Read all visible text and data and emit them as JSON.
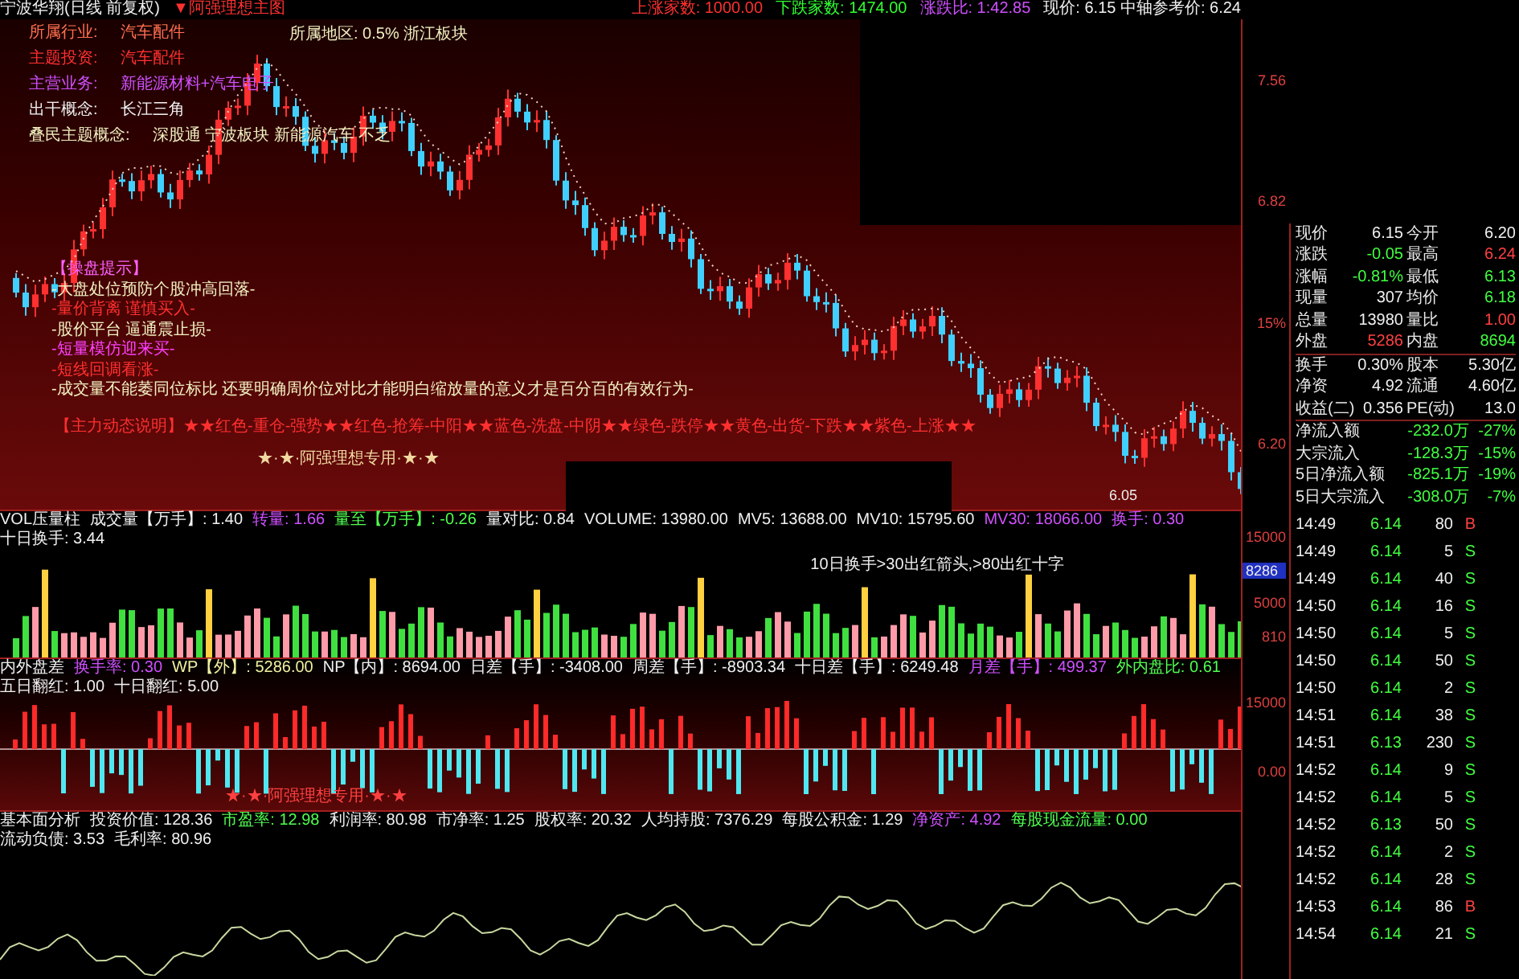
{
  "header": {
    "title": "宁波华翔(日线 前复权)",
    "indicator": "▼阿强理想主图",
    "stats": [
      {
        "text": "上涨家数: 1000.00",
        "color": "#ff3030"
      },
      {
        "text": "下跌家数: 1474.00",
        "color": "#30ff30"
      },
      {
        "text": "涨跌比: 1:42.85",
        "color": "#d050ff"
      }
    ],
    "price_info": "现价: 6.15 中轴参考价: 6.24"
  },
  "main_chart": {
    "info": [
      {
        "label": "所属行业:",
        "value": "汽车配件",
        "color": "#ff7050"
      },
      {
        "label": "主题投资:",
        "value": "汽车配件",
        "color": "#ff3030"
      },
      {
        "label": "主营业务:",
        "value": "新能源材料+汽车电子",
        "color": "#d050ff"
      },
      {
        "label": "出干概念:",
        "value": "长江三角",
        "color": "#f0f0f0"
      },
      {
        "label": "叠民主题概念:",
        "value": "深股通 宁波板块 新能源汽车 不乏",
        "color": "#f0f0c0"
      }
    ],
    "region": "所属地区: 0.5% 浙江板块",
    "tips": [
      {
        "text": "【操盘提示】",
        "color": "#ff60ff"
      },
      {
        "text": "-大盘处位预防个股冲高回落-",
        "color": "#f0f0c0"
      },
      {
        "text": "-量价背离 谨慎买入-",
        "color": "#ff3030"
      },
      {
        "text": "-股价平台 逼通震止损-",
        "color": "#f0f0c0"
      },
      {
        "text": "-短量模仿迎来买-",
        "color": "#ff40ff"
      },
      {
        "text": "-短线回调看涨-",
        "color": "#ff3030"
      },
      {
        "text": "-成交量不能萎同位标比 还要明确周价位对比才能明白缩放量的意义才是百分百的有效行为-",
        "color": "#f0f0c0"
      }
    ],
    "legend": "【主力动态说明】★★红色-重仓-强势★★红色-抢筹-中阳★★蓝色-洗盘-中阴★★绿色-跌停★★黄色-出货-下跌★★紫色-上涨★★",
    "signature": "★·★·阿强理想专用·★·★",
    "low_label": "6.05",
    "axis": [
      "7.56",
      "6.82",
      "15%",
      "6.20"
    ]
  },
  "volume_panel": {
    "items": [
      {
        "text": "VOL压量柱",
        "color": "#f0f0f0"
      },
      {
        "text": "成交量【万手】: 1.40",
        "color": "#f0f0f0"
      },
      {
        "text": "转量: 1.66",
        "color": "#d050ff"
      },
      {
        "text": "量至【万手】: -0.26",
        "color": "#50ff50"
      },
      {
        "text": "量对比: 0.84",
        "color": "#f0f0f0"
      },
      {
        "text": "VOLUME: 13980.00",
        "color": "#f0f0f0"
      },
      {
        "text": "MV5: 13688.00",
        "color": "#f0f0f0"
      },
      {
        "text": "MV10: 15795.60",
        "color": "#f0f0f0"
      },
      {
        "text": "MV30: 18066.00",
        "color": "#d050ff"
      },
      {
        "text": "换手: 0.30",
        "color": "#d050ff"
      },
      {
        "text": "十日换手: 3.44",
        "color": "#f0f0f0"
      }
    ],
    "note": "10日换手>30出红箭头,>80出红十字",
    "axis": [
      "15000",
      "5000",
      "810"
    ],
    "marker": "8286"
  },
  "diff_panel": {
    "items": [
      {
        "text": "内外盘差",
        "color": "#f0f0f0"
      },
      {
        "text": "换手率: 0.30",
        "color": "#d050ff"
      },
      {
        "text": "WP【外】: 5286.00",
        "color": "#f0f0a0"
      },
      {
        "text": "NP【内】: 8694.00",
        "color": "#f0f0f0"
      },
      {
        "text": "日差【手】: -3408.00",
        "color": "#f0f0f0"
      },
      {
        "text": "周差【手】: -8903.34",
        "color": "#f0f0f0"
      },
      {
        "text": "十日差【手】: 6249.48",
        "color": "#f0f0f0"
      },
      {
        "text": "月差【手】: 499.37",
        "color": "#d050ff"
      },
      {
        "text": "外内盘比: 0.61",
        "color": "#50ff50"
      },
      {
        "text": "五日翻红: 1.00",
        "color": "#f0f0f0"
      },
      {
        "text": "十日翻红: 5.00",
        "color": "#f0f0f0"
      }
    ],
    "signature": "★·★·阿强理想专用·★·★",
    "axis": [
      "15000",
      "0.00"
    ]
  },
  "fundamental_panel": {
    "items": [
      {
        "text": "基本面分析",
        "color": "#f0f0f0"
      },
      {
        "text": "投资价值: 128.36",
        "color": "#f0f0f0"
      },
      {
        "text": "市盈率: 12.98",
        "color": "#50ff50"
      },
      {
        "text": "利润率: 80.98",
        "color": "#f0f0f0"
      },
      {
        "text": "市净率: 1.25",
        "color": "#f0f0f0"
      },
      {
        "text": "股权率: 20.32",
        "color": "#f0f0f0"
      },
      {
        "text": "人均持股: 7376.29",
        "color": "#f0f0f0"
      },
      {
        "text": "每股公积金: 1.29",
        "color": "#f0f0f0"
      },
      {
        "text": "净资产: 4.92",
        "color": "#d050ff"
      },
      {
        "text": "每股现金流量: 0.00",
        "color": "#50ff50"
      },
      {
        "text": "流动负债: 3.53",
        "color": "#f0f0f0"
      },
      {
        "text": "毛利率: 80.96",
        "color": "#f0f0f0"
      }
    ]
  },
  "quote": [
    {
      "cells": [
        {
          "label": "现价",
          "value": "6.15",
          "color": "#f0f0f0"
        },
        {
          "label": "今开",
          "value": "6.20",
          "color": "#f0f0f0"
        }
      ]
    },
    {
      "cells": [
        {
          "label": "涨跌",
          "value": "-0.05",
          "color": "#40ff40"
        },
        {
          "label": "最高",
          "value": "6.24",
          "color": "#ff4040"
        }
      ]
    },
    {
      "cells": [
        {
          "label": "涨幅",
          "value": "-0.81%",
          "color": "#40ff40"
        },
        {
          "label": "最低",
          "value": "6.13",
          "color": "#40ff40"
        }
      ]
    },
    {
      "cells": [
        {
          "label": "现量",
          "value": "307",
          "color": "#f0f0f0"
        },
        {
          "label": "均价",
          "value": "6.18",
          "color": "#40ff40"
        }
      ]
    },
    {
      "cells": [
        {
          "label": "总量",
          "value": "13980",
          "color": "#f0f0f0"
        },
        {
          "label": "量比",
          "value": "1.00",
          "color": "#ff4040"
        }
      ]
    },
    {
      "cells": [
        {
          "label": "外盘",
          "value": "5286",
          "color": "#ff4040"
        },
        {
          "label": "内盘",
          "value": "8694",
          "color": "#40ff40"
        }
      ]
    },
    {
      "cells": [
        {
          "label": "换手",
          "value": "0.30%",
          "color": "#f0f0f0"
        },
        {
          "label": "股本",
          "value": "5.30亿",
          "color": "#f0f0f0"
        }
      ]
    },
    {
      "cells": [
        {
          "label": "净资",
          "value": "4.92",
          "color": "#f0f0f0"
        },
        {
          "label": "流通",
          "value": "4.60亿",
          "color": "#f0f0f0"
        }
      ]
    },
    {
      "cells": [
        {
          "label": "收益(二)",
          "value": "0.356",
          "color": "#f0f0f0"
        },
        {
          "label": "PE(动)",
          "value": "13.0",
          "color": "#f0f0f0"
        }
      ]
    }
  ],
  "flows": [
    {
      "label": "净流入额",
      "value": "-232.0万",
      "percent": "-27%"
    },
    {
      "label": "大宗流入",
      "value": "-128.3万",
      "percent": "-15%"
    },
    {
      "label": "5日净流入额",
      "value": "-825.1万",
      "percent": "-19%"
    },
    {
      "label": "5日大宗流入",
      "value": "-308.0万",
      "percent": "-7%"
    }
  ],
  "ticks": [
    {
      "time": "14:49",
      "price": "6.14",
      "volume": "80",
      "side": "B",
      "kind": "buy"
    },
    {
      "time": "14:49",
      "price": "6.14",
      "volume": "5",
      "side": "S",
      "kind": "sell"
    },
    {
      "time": "14:49",
      "price": "6.14",
      "volume": "40",
      "side": "S",
      "kind": "sell"
    },
    {
      "time": "14:50",
      "price": "6.14",
      "volume": "16",
      "side": "S",
      "kind": "sell"
    },
    {
      "time": "14:50",
      "price": "6.14",
      "volume": "5",
      "side": "S",
      "kind": "sell"
    },
    {
      "time": "14:50",
      "price": "6.14",
      "volume": "50",
      "side": "S",
      "kind": "sell"
    },
    {
      "time": "14:50",
      "price": "6.14",
      "volume": "2",
      "side": "S",
      "kind": "sell"
    },
    {
      "time": "14:51",
      "price": "6.14",
      "volume": "38",
      "side": "S",
      "kind": "sell"
    },
    {
      "time": "14:51",
      "price": "6.13",
      "volume": "230",
      "side": "S",
      "kind": "sell"
    },
    {
      "time": "14:52",
      "price": "6.14",
      "volume": "9",
      "side": "S",
      "kind": "sell"
    },
    {
      "time": "14:52",
      "price": "6.14",
      "volume": "5",
      "side": "S",
      "kind": "sell"
    },
    {
      "time": "14:52",
      "price": "6.13",
      "volume": "50",
      "side": "S",
      "kind": "sell"
    },
    {
      "time": "14:52",
      "price": "6.14",
      "volume": "2",
      "side": "S",
      "kind": "sell"
    },
    {
      "time": "14:52",
      "price": "6.14",
      "volume": "28",
      "side": "S",
      "kind": "sell"
    },
    {
      "time": "14:53",
      "price": "6.14",
      "volume": "86",
      "side": "B",
      "kind": "buy"
    },
    {
      "time": "14:54",
      "price": "6.14",
      "volume": "21",
      "side": "S",
      "kind": "sell"
    }
  ]
}
